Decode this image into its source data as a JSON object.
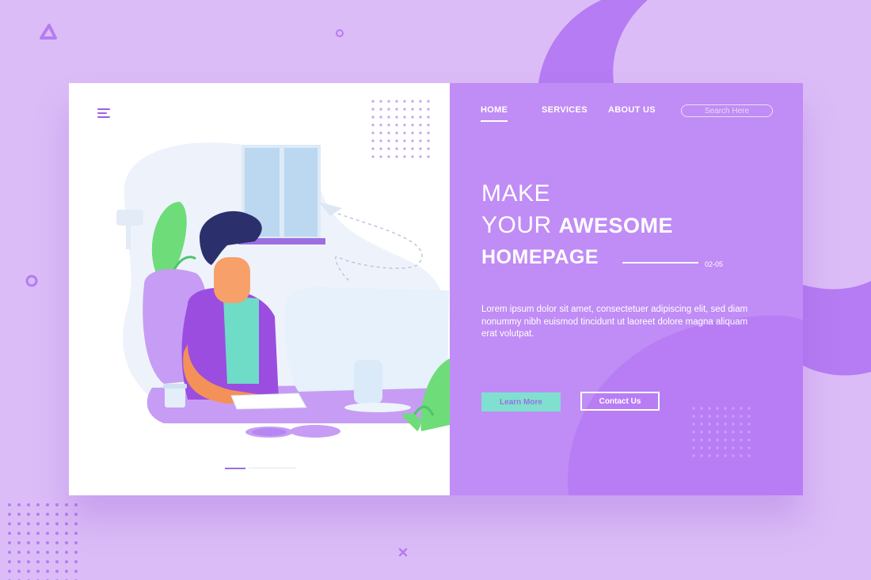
{
  "colors": {
    "background": "#dcbcf7",
    "panel": "#c08cf5",
    "accent": "#9b5de5",
    "button_teal": "#7fe0d0",
    "white": "#ffffff"
  },
  "nav": {
    "menu_icon": "hamburger-menu-icon",
    "items": [
      {
        "label": "HOME",
        "active": true
      },
      {
        "label": "SERVICES",
        "active": false
      },
      {
        "label": "ABOUT US",
        "active": false
      }
    ],
    "search_placeholder": "Search Here"
  },
  "hero": {
    "line1": "MAKE",
    "line2_thin": "YOUR",
    "line2_bold": "AWESOME",
    "line3_bold": "HOMEPAGE",
    "pager": "02-05",
    "description": "Lorem ipsum dolor sit amet, consectetuer adipiscing elit, sed diam nonummy nibh euismod tincidunt ut laoreet dolore magna aliquam erat volutpat."
  },
  "buttons": {
    "learn_more": "Learn More",
    "contact_us": "Contact Us"
  },
  "illustration": {
    "subject": "man-working-at-computer-illustration"
  }
}
